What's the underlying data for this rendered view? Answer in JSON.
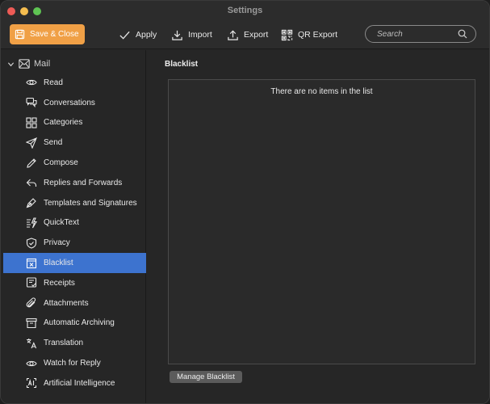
{
  "window": {
    "title": "Settings"
  },
  "toolbar": {
    "save_close": "Save & Close",
    "apply": "Apply",
    "import": "Import",
    "export": "Export",
    "qr_export": "QR Export",
    "search_placeholder": "Search"
  },
  "sidebar": {
    "section": "Mail",
    "items": [
      {
        "label": "Read",
        "icon": "eye-icon"
      },
      {
        "label": "Conversations",
        "icon": "chat-bubbles-icon"
      },
      {
        "label": "Categories",
        "icon": "grid-icon"
      },
      {
        "label": "Send",
        "icon": "paper-plane-icon"
      },
      {
        "label": "Compose",
        "icon": "pencil-icon"
      },
      {
        "label": "Replies and Forwards",
        "icon": "reply-icon"
      },
      {
        "label": "Templates and Signatures",
        "icon": "pen-nib-icon"
      },
      {
        "label": "QuickText",
        "icon": "quicktext-icon"
      },
      {
        "label": "Privacy",
        "icon": "shield-icon"
      },
      {
        "label": "Blacklist",
        "icon": "blacklist-icon"
      },
      {
        "label": "Receipts",
        "icon": "receipt-icon"
      },
      {
        "label": "Attachments",
        "icon": "paperclip-icon"
      },
      {
        "label": "Automatic Archiving",
        "icon": "archive-box-icon"
      },
      {
        "label": "Translation",
        "icon": "translate-icon"
      },
      {
        "label": "Watch for Reply",
        "icon": "watch-eye-icon"
      },
      {
        "label": "Artificial Intelligence",
        "icon": "ai-icon"
      }
    ],
    "active_index": 9
  },
  "main": {
    "title": "Blacklist",
    "empty_message": "There are no items in the list",
    "manage_button": "Manage Blacklist"
  },
  "colors": {
    "accent_save": "#f0a046",
    "selection": "#3d73cf",
    "background": "#262626"
  }
}
